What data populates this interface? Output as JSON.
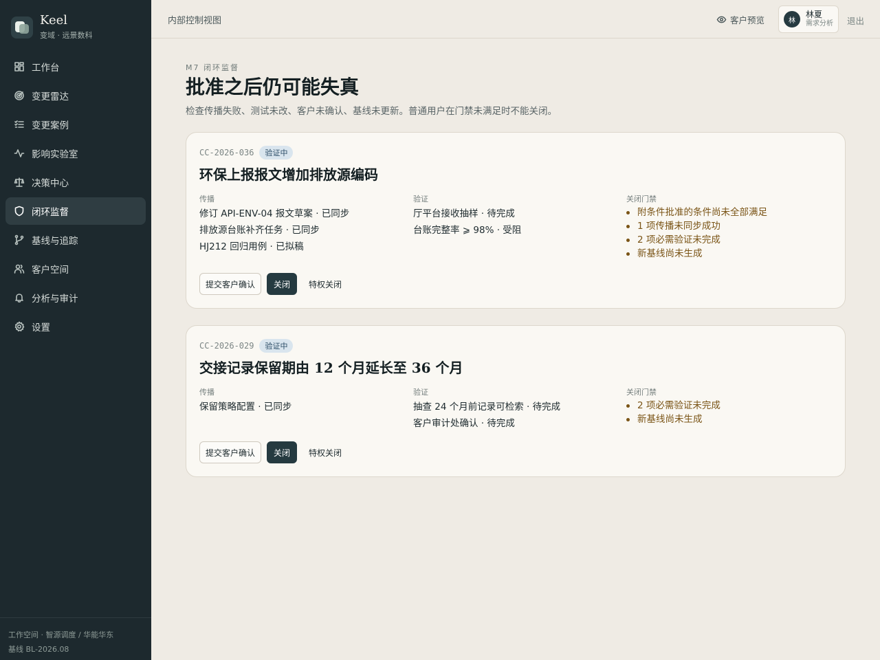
{
  "colors": {
    "sidebar_bg": "#1d292e",
    "page_bg": "#efebe4",
    "accent": "#253a40",
    "gate_text": "#7a5416",
    "badge_bg": "#d9e5ee"
  },
  "brand": {
    "name": "Keel",
    "subtitle": "变域 · 远景数科"
  },
  "sidebar": {
    "items": [
      {
        "label": "工作台",
        "icon": "dashboard-icon"
      },
      {
        "label": "变更雷达",
        "icon": "radar-icon"
      },
      {
        "label": "变更案例",
        "icon": "checklist-icon"
      },
      {
        "label": "影响实验室",
        "icon": "activity-icon"
      },
      {
        "label": "决策中心",
        "icon": "scale-icon"
      },
      {
        "label": "闭环监督",
        "icon": "shield-icon",
        "active": true
      },
      {
        "label": "基线与追踪",
        "icon": "branch-icon"
      },
      {
        "label": "客户空间",
        "icon": "users-icon"
      },
      {
        "label": "分析与审计",
        "icon": "bell-icon"
      },
      {
        "label": "设置",
        "icon": "gear-icon"
      }
    ],
    "footer": {
      "workspace": "工作空间 · 智源调度 / 华能华东",
      "baseline": "基线 BL-2026.08"
    }
  },
  "header": {
    "title": "内部控制视图",
    "preview": "客户预览",
    "user": {
      "initial": "林",
      "name": "林夏",
      "role": "需求分析"
    },
    "logout": "退出"
  },
  "page": {
    "kicker": "M7 闭环监督",
    "title": "批准之后仍可能失真",
    "description": "检查传播失败、测试未改、客户未确认、基线未更新。普通用户在门禁未满足时不能关闭。"
  },
  "column_labels": {
    "propagation": "传播",
    "verification": "验证",
    "gate": "关闭门禁"
  },
  "buttons": {
    "submit_confirm": "提交客户确认",
    "close": "关闭",
    "privileged_close": "特权关闭"
  },
  "cards": [
    {
      "id": "CC-2026-036",
      "status": "验证中",
      "title": "环保上报报文增加排放源编码",
      "propagation": [
        "修订 API-ENV-04 报文草案 · 已同步",
        "排放源台账补齐任务 · 已同步",
        "HJ212 回归用例 · 已拟稿"
      ],
      "verification": [
        "厅平台接收抽样 · 待完成",
        "台账完整率 ⩾ 98% · 受阻"
      ],
      "gates": [
        "附条件批准的条件尚未全部满足",
        "1 项传播未同步成功",
        "2 项必需验证未完成",
        "新基线尚未生成"
      ]
    },
    {
      "id": "CC-2026-029",
      "status": "验证中",
      "title": "交接记录保留期由 12 个月延长至 36 个月",
      "propagation": [
        "保留策略配置 · 已同步"
      ],
      "verification": [
        "抽查 24 个月前记录可检索 · 待完成",
        "客户审计处确认 · 待完成"
      ],
      "gates": [
        "2 项必需验证未完成",
        "新基线尚未生成"
      ]
    }
  ]
}
